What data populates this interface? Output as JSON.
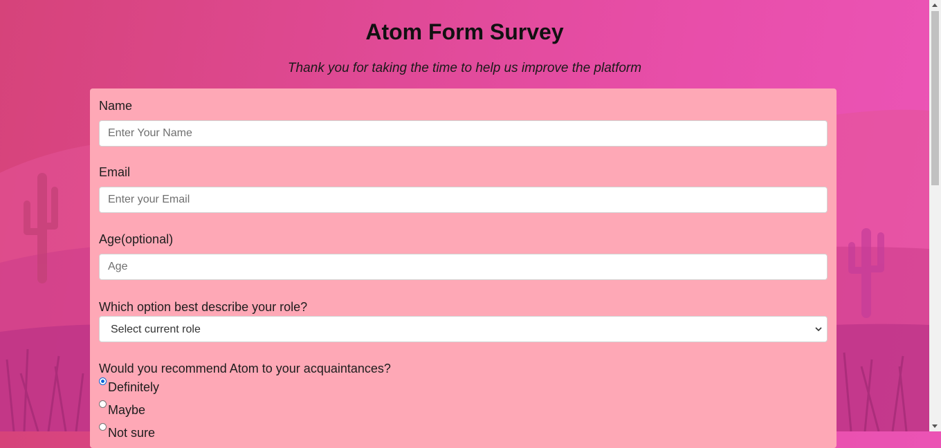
{
  "page": {
    "title": "Atom Form Survey",
    "subtitle": "Thank you for taking the time to help us improve the platform"
  },
  "form": {
    "name": {
      "label": "Name",
      "placeholder": "Enter Your Name",
      "value": ""
    },
    "email": {
      "label": "Email",
      "placeholder": "Enter your Email",
      "value": ""
    },
    "age": {
      "label": "Age(optional)",
      "placeholder": "Age",
      "value": ""
    },
    "role": {
      "label": "Which option best describe your role?",
      "selected": "Select current role"
    },
    "recommend": {
      "label": "Would you recommend Atom to your acquaintances?",
      "options": [
        {
          "label": "Definitely",
          "checked": true
        },
        {
          "label": "Maybe",
          "checked": false
        },
        {
          "label": "Not sure",
          "checked": false
        }
      ]
    }
  },
  "colors": {
    "background_start": "#d6437a",
    "background_end": "#ec55b8",
    "form_background": "#fea8b6",
    "radio_accent": "#0a66d8"
  },
  "icons": {
    "select_arrow": "chevron-down-icon"
  }
}
